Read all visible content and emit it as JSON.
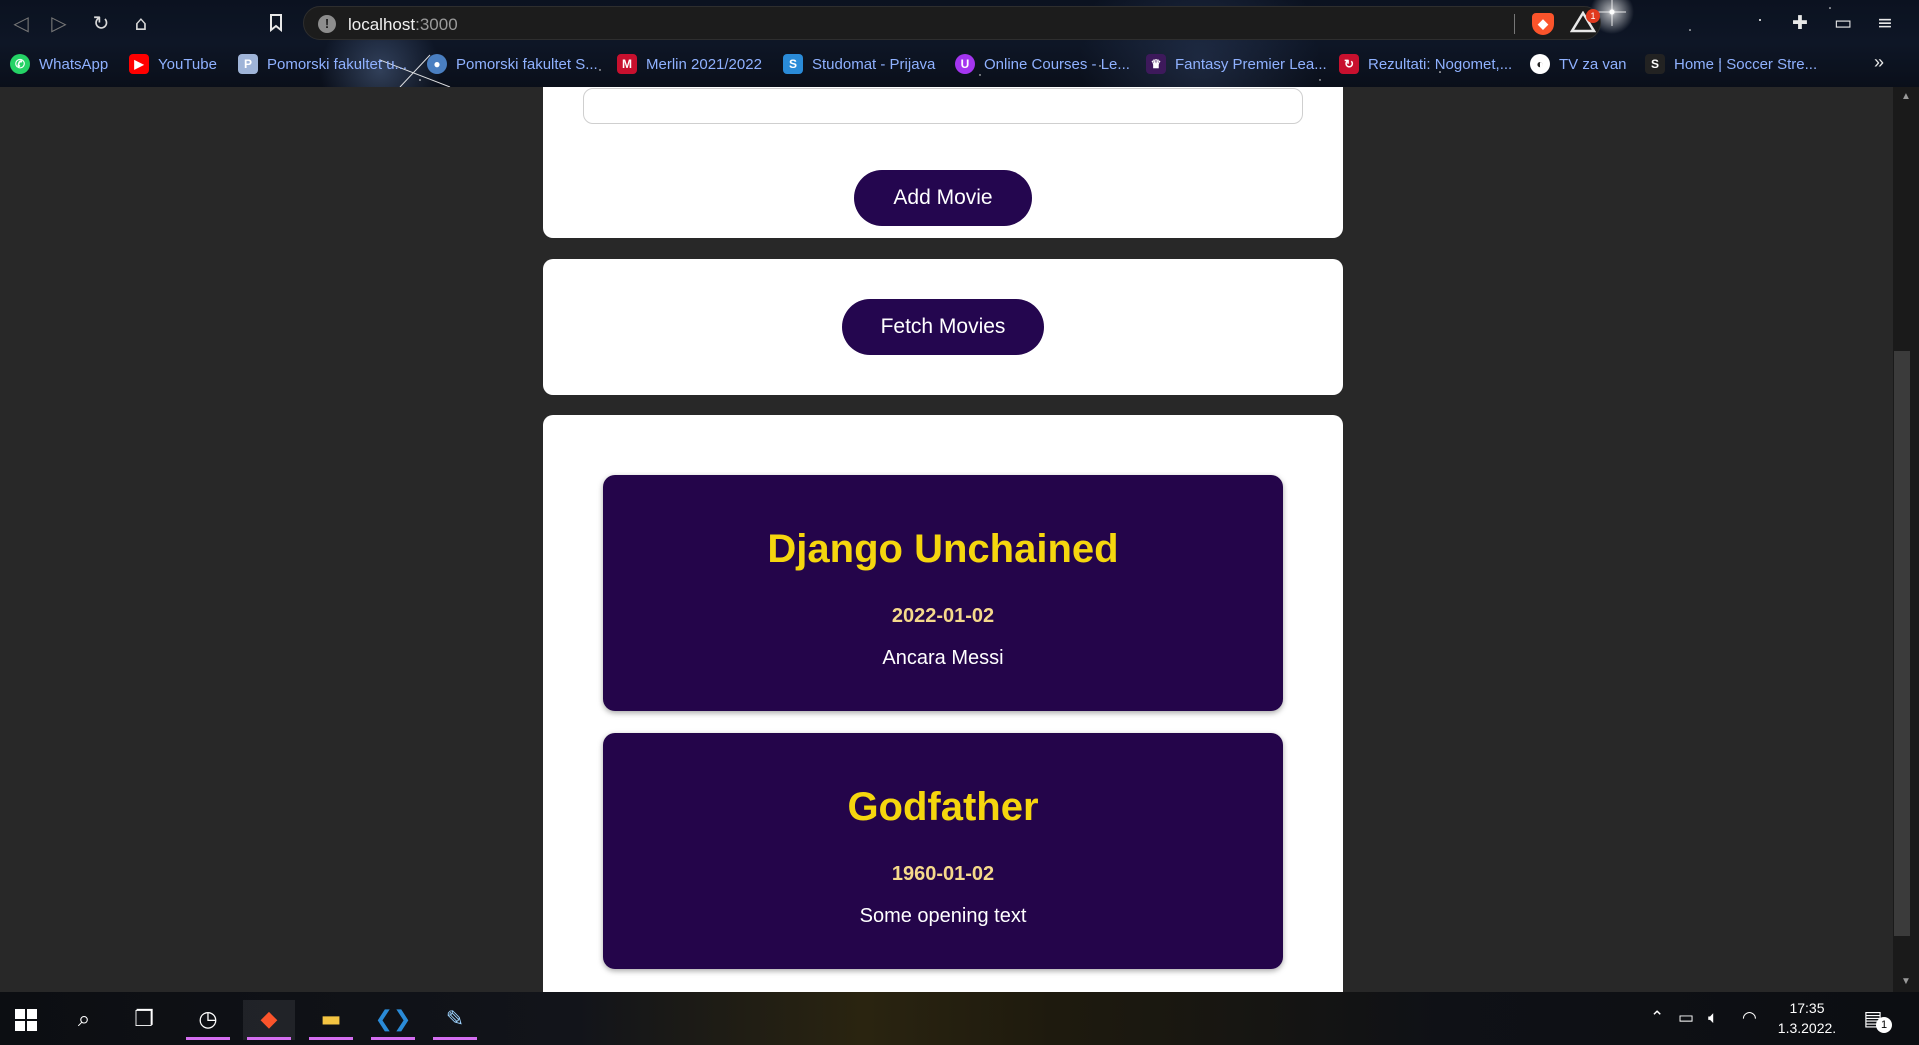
{
  "browser": {
    "url_host": "localhost",
    "url_port": ":3000",
    "rewards_badge": "1"
  },
  "bookmarks": [
    {
      "label": "WhatsApp",
      "icon": "whatsapp-icon",
      "color": "#25d366",
      "glyph": "✆"
    },
    {
      "label": "YouTube",
      "icon": "youtube-icon",
      "color": "#ff0000",
      "glyph": "▶"
    },
    {
      "label": "Pomorski fakultet u...",
      "icon": "pfst-icon",
      "color": "#9fb4d8",
      "glyph": "P"
    },
    {
      "label": "Pomorski fakultet S...",
      "icon": "pfst-globe-icon",
      "color": "#4a7fc1",
      "glyph": "●"
    },
    {
      "label": "Merlin 2021/2022",
      "icon": "merlin-icon",
      "color": "#c8102e",
      "glyph": "M"
    },
    {
      "label": "Studomat - Prijava",
      "icon": "studomat-icon",
      "color": "#2a8bd8",
      "glyph": "S"
    },
    {
      "label": "Online Courses - Le...",
      "icon": "udemy-icon",
      "color": "#a435f0",
      "glyph": "U"
    },
    {
      "label": "Fantasy Premier Lea...",
      "icon": "premier-league-icon",
      "color": "#3d195b",
      "glyph": "♛"
    },
    {
      "label": "Rezultati: Nogomet,...",
      "icon": "rezultati-icon",
      "color": "#c8102e",
      "glyph": "↻"
    },
    {
      "label": "TV za van",
      "icon": "tv-icon",
      "color": "#ffffff",
      "glyph": "◐"
    },
    {
      "label": "Home | Soccer Stre...",
      "icon": "soccer-streams-icon",
      "color": "#222222",
      "glyph": "S"
    }
  ],
  "page": {
    "add_movie_button": "Add Movie",
    "fetch_movies_button": "Fetch Movies",
    "movies": [
      {
        "title": "Django Unchained",
        "release_date": "2022-01-02",
        "opening_text": "Ancara Messi"
      },
      {
        "title": "Godfather",
        "release_date": "1960-01-02",
        "opening_text": "Some opening text"
      }
    ]
  },
  "colors": {
    "button_bg": "#24064f",
    "movie_bg": "#24054a",
    "movie_title": "#f5d60e",
    "page_bg": "#282828"
  },
  "taskbar": {
    "time": "17:35",
    "date": "1.3.2022.",
    "notifications": "1"
  }
}
